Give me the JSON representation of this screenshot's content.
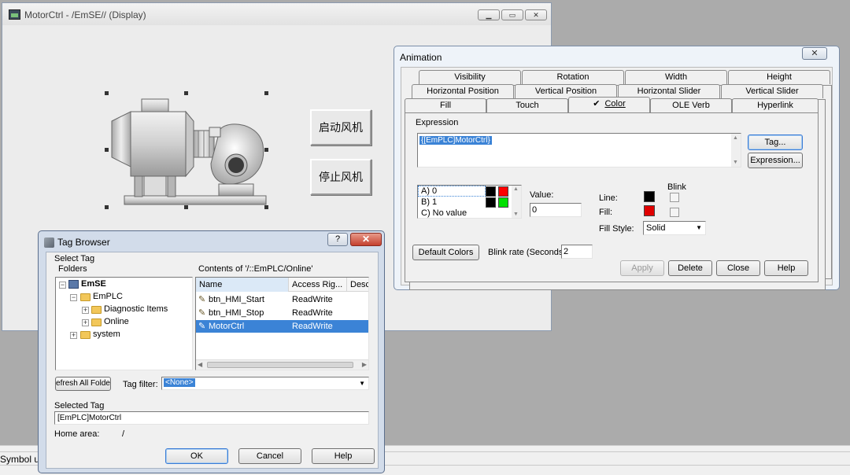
{
  "bottom": {
    "label": "Symbol u"
  },
  "display_window": {
    "title": "MotorCtrl - /EmSE// (Display)",
    "start_button": "启动风机",
    "stop_button": "停止风机"
  },
  "animation": {
    "title": "Animation",
    "close_icon": "✕",
    "tabs_row1": [
      "Visibility",
      "Rotation",
      "Width",
      "Height"
    ],
    "tabs_row2": [
      "Horizontal Position",
      "Vertical Position",
      "Horizontal Slider",
      "Vertical Slider"
    ],
    "tabs_row3": [
      "Fill",
      "Touch",
      "Color",
      "OLE Verb",
      "Hyperlink"
    ],
    "active_check": "✔",
    "expression_label": "Expression",
    "expression_value": "{[EmPLC]MotorCtrl}",
    "tag_button": "Tag...",
    "expression_button": "Expression...",
    "states": [
      "A) 0",
      "B) 1",
      "C) No value"
    ],
    "state_colors": [
      [
        "#000000",
        "#ff0000"
      ],
      [
        "#000000",
        "#00e000"
      ]
    ],
    "value_label": "Value:",
    "value_input": "0",
    "line_label": "Line:",
    "fill_label": "Fill:",
    "blink_label": "Blink",
    "line_color": "#000000",
    "fill_color": "#e00000",
    "fill_style_label": "Fill Style:",
    "fill_style_value": "Solid",
    "default_colors_button": "Default Colors",
    "blink_rate_label": "Blink rate (Seconds):",
    "blink_rate_value": "2",
    "apply_button": "Apply",
    "delete_button": "Delete",
    "close_button": "Close",
    "help_button": "Help"
  },
  "tag_browser": {
    "title": "Tag Browser",
    "help_icon": "?",
    "close_icon": "✕",
    "select_tag_label": "Select Tag",
    "folders_header": "Folders",
    "contents_header": "Contents of '/::EmPLC/Online'",
    "tree": {
      "root": "EmSE",
      "child": "EmPLC",
      "diag": "Diagnostic Items",
      "online": "Online",
      "system": "system"
    },
    "columns": [
      "Name",
      "Access Rig...",
      "Desc"
    ],
    "rows": [
      {
        "name": "btn_HMI_Start",
        "access": "ReadWrite"
      },
      {
        "name": "btn_HMI_Stop",
        "access": "ReadWrite"
      },
      {
        "name": "MotorCtrl",
        "access": "ReadWrite"
      }
    ],
    "refresh_button": "efresh All Folde",
    "tag_filter_label": "Tag filter:",
    "tag_filter_value": "<None>",
    "selected_tag_label": "Selected Tag",
    "selected_tag_value": "[EmPLC]MotorCtrl",
    "home_area_label": "Home area:",
    "home_area_value": "/",
    "ok_button": "OK",
    "cancel_button": "Cancel",
    "help_button": "Help"
  }
}
